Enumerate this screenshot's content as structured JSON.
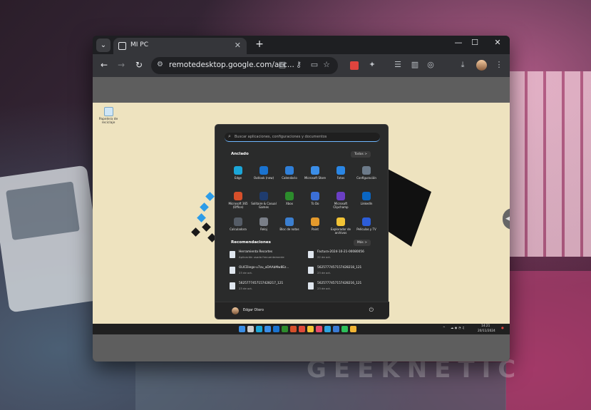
{
  "background": {
    "watermark": "GEEKNETIC"
  },
  "browser": {
    "tab_title": "MI PC",
    "url": "remotedesktop.google.com/acc..."
  },
  "desktop": {
    "recycle_bin_label": "Papelera de reciclaje"
  },
  "start_menu": {
    "search_placeholder": "Buscar aplicaciones, configuraciones y documentos",
    "pinned_title": "Anclado",
    "all_button": "Todos >",
    "pinned_apps": [
      {
        "label": "Edge",
        "color": "#1ba6d8"
      },
      {
        "label": "Outlook (new)",
        "color": "#1a73d0"
      },
      {
        "label": "Calendario",
        "color": "#2f7fd8"
      },
      {
        "label": "Microsoft Store",
        "color": "#3b8ee8"
      },
      {
        "label": "Fotos",
        "color": "#2a86e4"
      },
      {
        "label": "Configuración",
        "color": "#6c7a89"
      },
      {
        "label": "Microsoft 365 (Office)",
        "color": "#d64f2a"
      },
      {
        "label": "Solitaire & Casual Games",
        "color": "#1f3c6e"
      },
      {
        "label": "Xbox",
        "color": "#2c8c2c"
      },
      {
        "label": "To Do",
        "color": "#3b6fd6"
      },
      {
        "label": "Microsoft Clipchamp",
        "color": "#6b3fc4"
      },
      {
        "label": "LinkedIn",
        "color": "#0a66c2"
      },
      {
        "label": "Calculadora",
        "color": "#555c66"
      },
      {
        "label": "Reloj",
        "color": "#7a7f88"
      },
      {
        "label": "Bloc de notas",
        "color": "#3b7fd0"
      },
      {
        "label": "Paint",
        "color": "#e49a2c"
      },
      {
        "label": "Explorador de archivos",
        "color": "#f2c335"
      },
      {
        "label": "Películas y TV",
        "color": "#2c5dd8"
      }
    ],
    "recommended_title": "Recomendaciones",
    "more_button": "Más >",
    "recommended": [
      {
        "title": "Herramienta Recortes",
        "sub": "Aplicación usada frecuentemente"
      },
      {
        "title": "Factura-2024-10-21-00080056",
        "sub": "22 de oct."
      },
      {
        "title": "OLICDiego-u7zu_aDAAbMw8Ez...",
        "sub": "23 de oct."
      },
      {
        "title": "5625777457157428218_121",
        "sub": "23 de oct."
      },
      {
        "title": "5625777457157428217_121",
        "sub": "23 de oct."
      },
      {
        "title": "5625777457157428216_121",
        "sub": "23 de oct."
      }
    ],
    "user_name": "Edgar Otero"
  },
  "taskbar": {
    "time": "14:21",
    "date": "20/11/2024",
    "apps": [
      {
        "name": "start",
        "color": "#3a8ee6"
      },
      {
        "name": "search",
        "color": "#cccccc"
      },
      {
        "name": "edge",
        "color": "#1ba6d8"
      },
      {
        "name": "store",
        "color": "#3b8ee8"
      },
      {
        "name": "mail",
        "color": "#1a73d0"
      },
      {
        "name": "app",
        "color": "#2c8c2c"
      },
      {
        "name": "app",
        "color": "#d64f2a"
      },
      {
        "name": "app",
        "color": "#e04a3a"
      },
      {
        "name": "files",
        "color": "#f2c335"
      },
      {
        "name": "music",
        "color": "#e84a6a"
      },
      {
        "name": "telegram",
        "color": "#2ea3e0"
      },
      {
        "name": "app",
        "color": "#3a7bd5"
      },
      {
        "name": "whatsapp",
        "color": "#2cc05a"
      },
      {
        "name": "chrome",
        "color": "#f2b533"
      }
    ]
  }
}
